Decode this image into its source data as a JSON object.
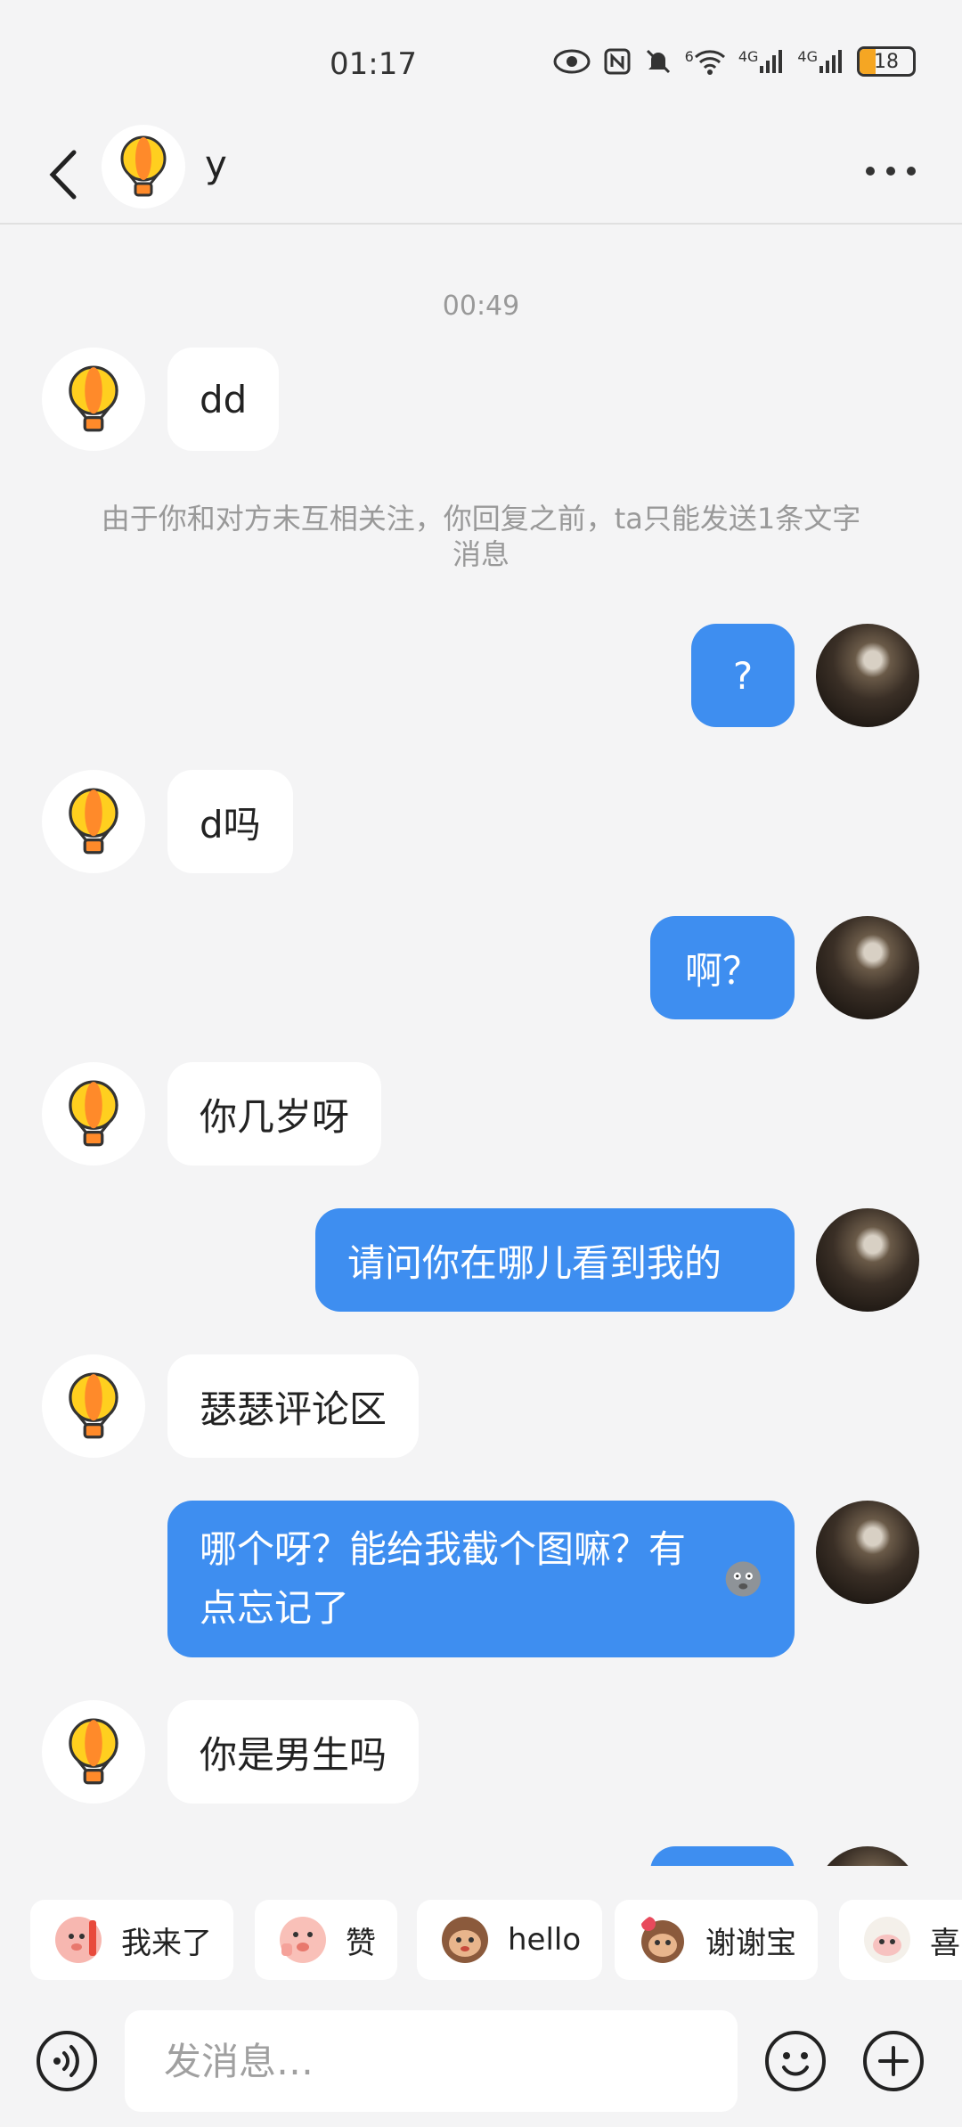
{
  "status_bar": {
    "time": "01:17",
    "signal_1": "4G",
    "signal_2": "4G",
    "wifi_badge": "6",
    "battery": "18",
    "icons": [
      "eye-icon",
      "nfc-icon",
      "mute-icon",
      "wifi-icon",
      "signal-icon",
      "signal-icon",
      "battery-icon"
    ]
  },
  "header": {
    "contact_name": "y",
    "back_icon": "chevron-left-icon",
    "more_icon": "more-dots-icon"
  },
  "chat": {
    "timestamp": "00:49",
    "system_note": "由于你和对方未互相关注，你回复之前，ta只能发送1条文字消息",
    "messages": [
      {
        "from": "them",
        "text": "dd"
      },
      {
        "from": "me",
        "text": "?"
      },
      {
        "from": "them",
        "text": "d吗"
      },
      {
        "from": "me",
        "text": "啊？"
      },
      {
        "from": "them",
        "text": "你几岁呀"
      },
      {
        "from": "me",
        "text": "请问你在哪儿看到我的"
      },
      {
        "from": "them",
        "text": "瑟瑟评论区"
      },
      {
        "from": "me",
        "text": "哪个呀？能给我截个图嘛？有点忘记了"
      },
      {
        "from": "them",
        "text": "你是男生吗"
      }
    ]
  },
  "quick_stickers": [
    {
      "label": "我来了",
      "icon": "sticker-pig-icon"
    },
    {
      "label": "赞",
      "icon": "sticker-thumbs-icon"
    },
    {
      "label": "hello",
      "icon": "sticker-monkey-icon"
    },
    {
      "label": "谢谢宝",
      "icon": "sticker-monkey-flower-icon"
    },
    {
      "label": "喜",
      "icon": "sticker-sheep-icon"
    }
  ],
  "composer": {
    "placeholder": "发消息…",
    "voice_icon": "voice-icon",
    "sticker_icon": "smiley-icon",
    "plus_icon": "plus-icon"
  },
  "colors": {
    "background": "#f4f4f5",
    "outgoing_bubble": "#3e8ef0",
    "incoming_bubble": "#ffffff",
    "meta_text": "#999999"
  }
}
